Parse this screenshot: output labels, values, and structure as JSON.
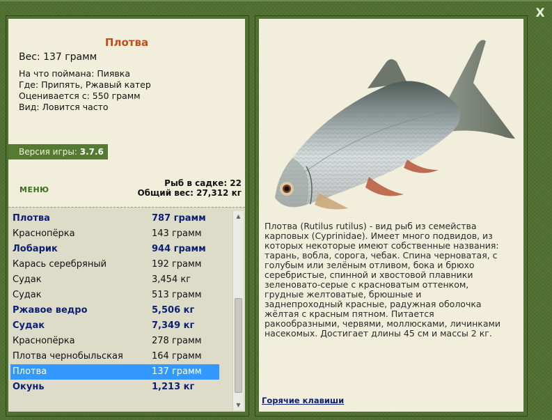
{
  "close_label": "X",
  "fish": {
    "name": "Плотва",
    "weight_line": "Вес: 137 грамм",
    "bait_line": "На что поймана: Пиявка",
    "where_line": "Где: Припять, Ржавый катер",
    "value_line": "Оценивается с: 550 грамм",
    "kind_line": "Вид: Ловится часто"
  },
  "version": {
    "label": "Версия игры:",
    "value": "3.7.6"
  },
  "menu_label": "МЕНЮ",
  "keepnet": {
    "count_line": "Рыб в садке: 22",
    "total_line": "Общий вес: 27,312 кг"
  },
  "catch_list": [
    {
      "name": "Плотва",
      "weight": "787 грамм",
      "bold": true
    },
    {
      "name": "Краснопёрка",
      "weight": "143 грамм",
      "bold": false
    },
    {
      "name": "Лобарик",
      "weight": "944 грамм",
      "bold": true
    },
    {
      "name": "Карась серебряный",
      "weight": "192 грамм",
      "bold": false
    },
    {
      "name": "Судак",
      "weight": "3,454 кг",
      "bold": false
    },
    {
      "name": "Судак",
      "weight": "513 грамм",
      "bold": false
    },
    {
      "name": "Ржавое ведро",
      "weight": "5,506 кг",
      "bold": true
    },
    {
      "name": "Судак",
      "weight": "7,349 кг",
      "bold": true
    },
    {
      "name": "Краснопёрка",
      "weight": "278 грамм",
      "bold": false
    },
    {
      "name": "Плотва чернобыльская",
      "weight": "164 грамм",
      "bold": false
    },
    {
      "name": "Плотва",
      "weight": "137 грамм",
      "bold": false,
      "selected": true
    },
    {
      "name": "Окунь",
      "weight": "1,213 кг",
      "bold": true
    }
  ],
  "description": "Плотва (Rutilus rutilus) - вид рыб из семейства карповых (Cyprinidae). Имеет много подвидов, из которых некоторые имеют собственные названия: тарань, вобла, сорога, чебак. Спина черноватая, с голубым или зелёным отливом, бока и брюхо серебристые, спинной и хвостовой плавники зеленовато-серые с красноватым оттенком, грудные желтоватые, брюшные и заднепроходный красные, радужная оболочка жёлтая с красным пятном. Питается ракообразными, червями, моллюсками, личинками насекомых. Достигает длины 45 см и массы 2 кг.",
  "hotkeys_label": "Горячие клавиши",
  "colors": {
    "frame": "#4f7030",
    "panel": "#f1efdb",
    "title": "#c14c1b",
    "bold_row": "#0d1f73",
    "selected_row": "#3399ff"
  }
}
